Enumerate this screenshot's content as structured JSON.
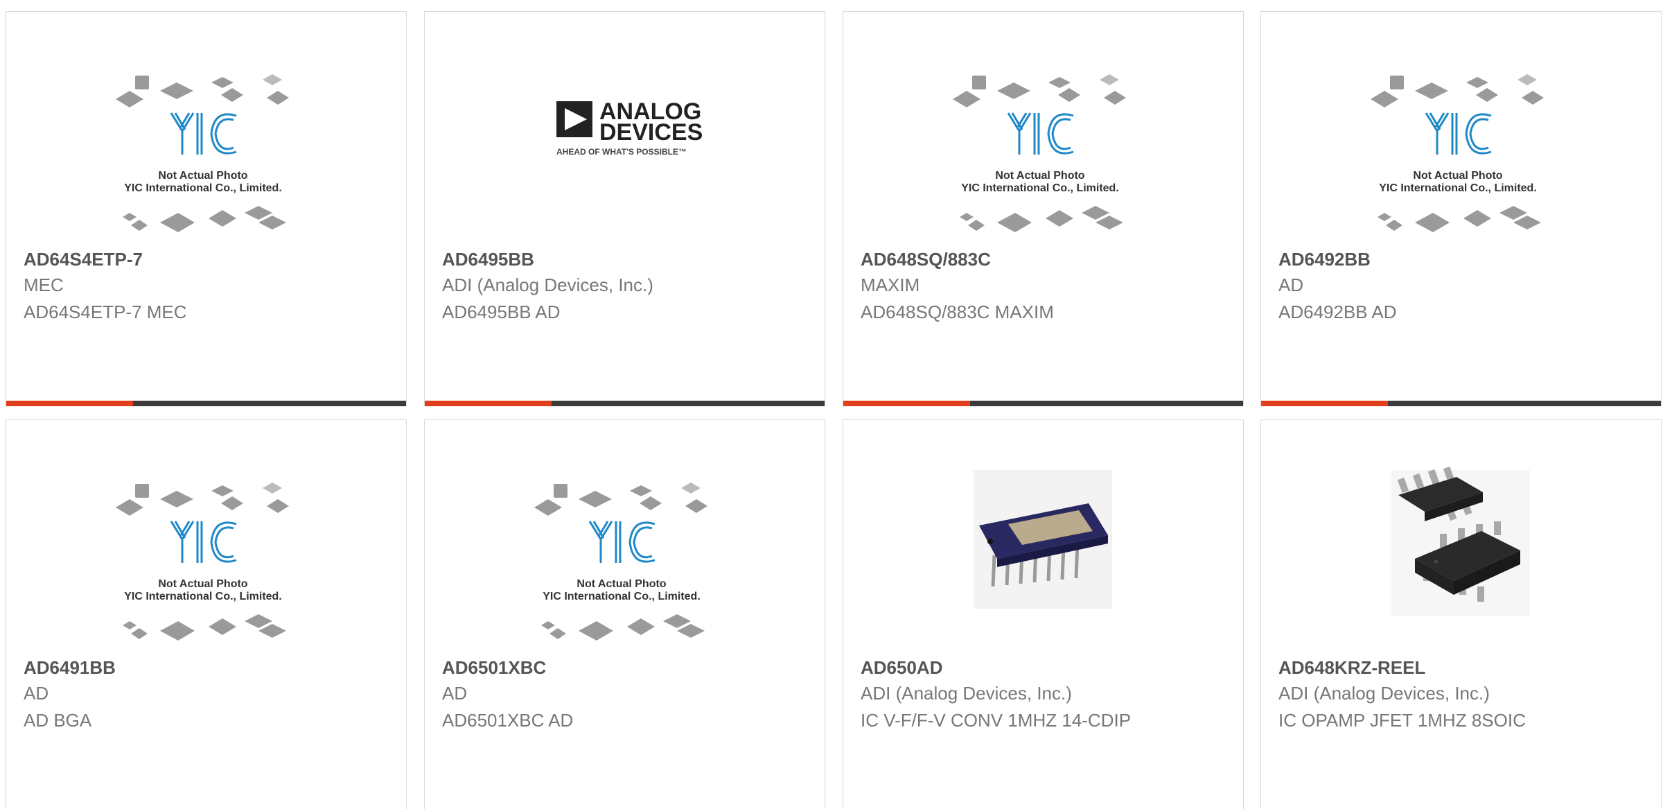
{
  "colors": {
    "accent": "#e2401c",
    "bar": "#3b3b3b",
    "border": "#d9d9d9",
    "part_number": "#555555",
    "text": "#777777",
    "yic_blue": "#1e88c8"
  },
  "placeholder": {
    "line1": "Not Actual Photo",
    "line2": "YIC International Co., Limited."
  },
  "adi_logo": {
    "line1": "ANALOG",
    "line2": "DEVICES",
    "tagline": "AHEAD OF WHAT'S POSSIBLE™"
  },
  "products": [
    {
      "part_number": "AD64S4ETP-7",
      "manufacturer": "MEC",
      "description": "AD64S4ETP-7 MEC",
      "image": "placeholder-icon"
    },
    {
      "part_number": "AD6495BB",
      "manufacturer": "ADI (Analog Devices, Inc.)",
      "description": "AD6495BB AD",
      "image": "analog-devices-logo"
    },
    {
      "part_number": "AD648SQ/883C",
      "manufacturer": "MAXIM",
      "description": "AD648SQ/883C MAXIM",
      "image": "placeholder-icon"
    },
    {
      "part_number": "AD6492BB",
      "manufacturer": "AD",
      "description": "AD6492BB AD",
      "image": "placeholder-icon"
    },
    {
      "part_number": "AD6491BB",
      "manufacturer": "AD",
      "description": "AD BGA",
      "image": "placeholder-icon"
    },
    {
      "part_number": "AD6501XBC",
      "manufacturer": "AD",
      "description": "AD6501XBC AD",
      "image": "placeholder-icon"
    },
    {
      "part_number": "AD650AD",
      "manufacturer": "ADI (Analog Devices, Inc.)",
      "description": "IC V-F/F-V CONV 1MHZ 14-CDIP",
      "image": "cdip-chip-photo"
    },
    {
      "part_number": "AD648KRZ-REEL",
      "manufacturer": "ADI (Analog Devices, Inc.)",
      "description": "IC OPAMP JFET 1MHZ 8SOIC",
      "image": "soic-chip-photo"
    }
  ]
}
